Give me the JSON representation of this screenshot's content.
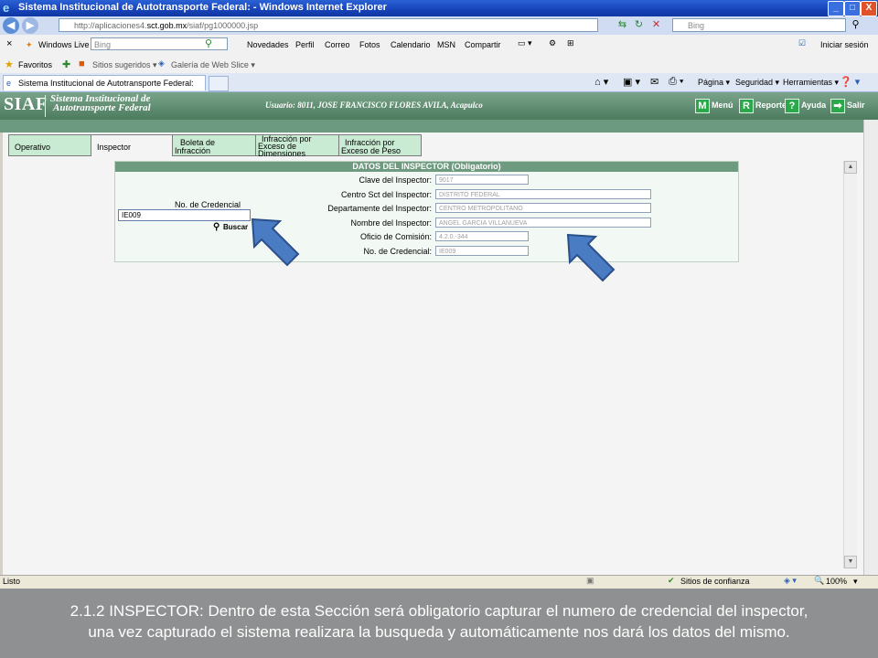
{
  "window": {
    "title": "Sistema Institucional de Autotransporte Federal: - Windows Internet Explorer",
    "minimize": "_",
    "maximize": "□",
    "close": "X"
  },
  "addressbar": {
    "url_prefix": "http://aplicaciones4.",
    "url_host": "sct.gob.mx",
    "url_path": "/siaf/pg1000000.jsp",
    "search_placeholder": "Bing"
  },
  "livebar": {
    "close": "×",
    "windows_live": "Windows Live",
    "search_placeholder": "Bing",
    "links": [
      "Novedades",
      "Perfil",
      "Correo",
      "Fotos",
      "Calendario",
      "MSN",
      "Compartir"
    ],
    "signin": "Iniciar sesión"
  },
  "favbar": {
    "favoritos": "Favoritos",
    "sitios": "Sitios sugeridos ▾",
    "galeria": "Galería de Web Slice ▾"
  },
  "tabbar": {
    "tab_title": "Sistema Institucional de Autotransporte Federal:",
    "commands": [
      "Página ▾",
      "Seguridad ▾",
      "Herramientas ▾"
    ]
  },
  "siaf": {
    "logo": "SIAF",
    "name_line1": "Sistema Institucional de",
    "name_line2": "Autotransporte Federal",
    "usuario": "Usuario: 8011, JOSE FRANCISCO FLORES AVILA, Acapulco",
    "menu_letter": "M",
    "menu_label": "Menú",
    "reporte_letter": "R",
    "reporte_label": "Reporte",
    "ayuda_letter": "?",
    "ayuda_label": "Ayuda",
    "salir_arrow": "➡",
    "salir_label": "Salir"
  },
  "tabs": {
    "operativo": "Operativo",
    "inspector": "Inspector",
    "boleta_1": "Boleta de",
    "boleta_2": "Infracción",
    "dim_1": "Infracción por",
    "dim_2": "Exceso de",
    "dim_3": "Dimensiones",
    "peso_1": "Infracción por",
    "peso_2": "Exceso de Peso"
  },
  "form": {
    "header": "DATOS DEL INSPECTOR (Obligatorio)",
    "search_label": "No. de Credencial",
    "search_value": "IE009",
    "search_button": "Buscar",
    "fields": [
      {
        "label": "Clave del Inspector:",
        "value": "9017"
      },
      {
        "label": "Centro Sct del Inspector:",
        "value": "DISTRITO FEDERAL"
      },
      {
        "label": "Departamente del Inspector:",
        "value": "CENTRO METROPOLITANO"
      },
      {
        "label": "Nombre del Inspector:",
        "value": "ANGEL GARCIA VILLANUEVA"
      },
      {
        "label": "Oficio de Comisión:",
        "value": "4.2.0.-344"
      },
      {
        "label": "No. de Credencial:",
        "value": "IE009"
      }
    ]
  },
  "status": {
    "listo": "Listo",
    "sitios": "Sitios de confianza",
    "zoom": "100%"
  },
  "caption": {
    "line1": "2.1.2 INSPECTOR: Dentro de esta Sección  será obligatorio capturar el numero de credencial del inspector,",
    "line2": "una vez capturado el sistema realizara la busqueda y automáticamente nos dará los datos del mismo."
  },
  "colors": {
    "siaf_green": "#4c7b5e",
    "tab_green": "#c9ebd3",
    "arrow_blue": "#4a7cc4"
  }
}
